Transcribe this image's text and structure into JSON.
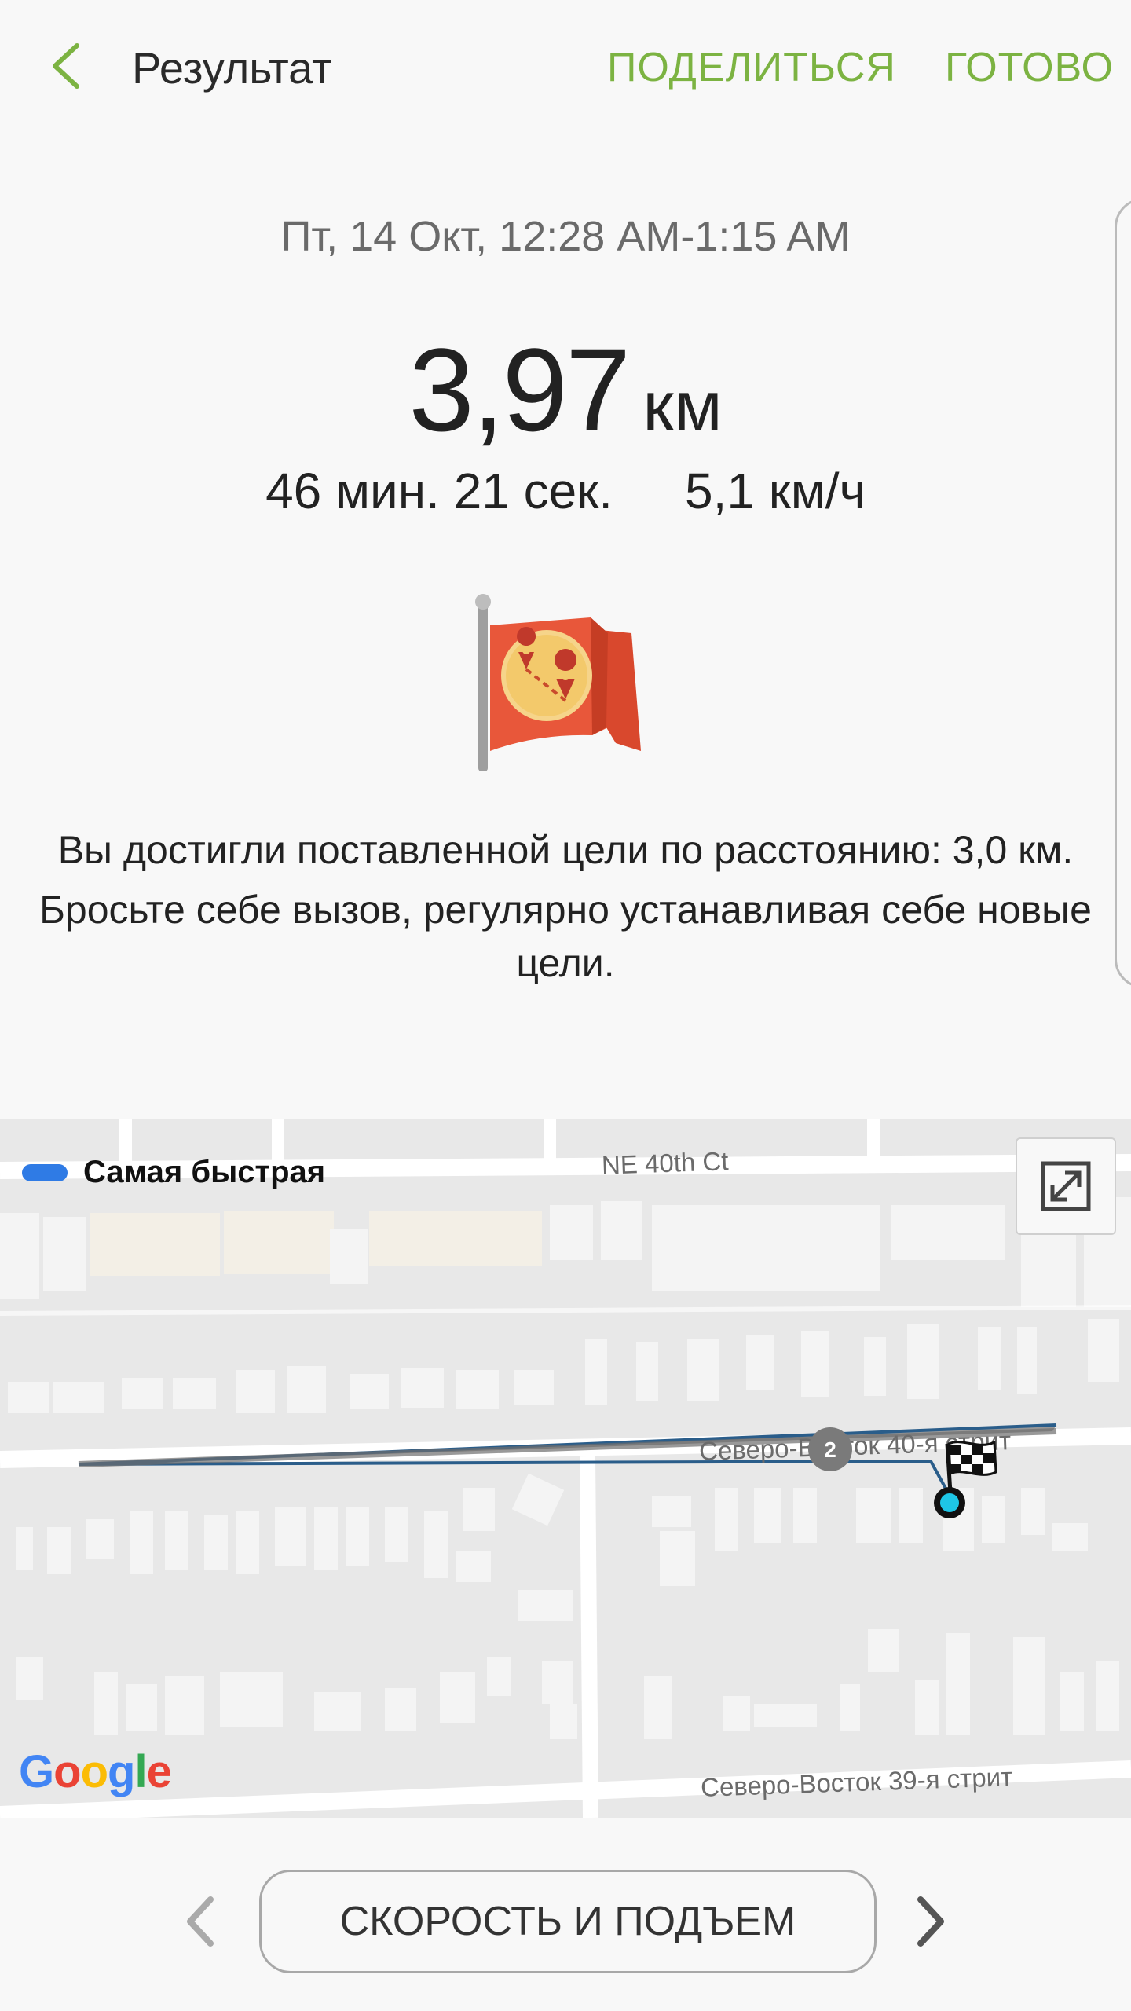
{
  "header": {
    "title": "Результат",
    "share_label": "ПОДЕЛИТЬСЯ",
    "done_label": "ГОТОВО"
  },
  "summary": {
    "date_range": "Пт, 14 Окт, 12:28 AM-1:15 AM",
    "distance_value": "3,97",
    "distance_unit": "км",
    "duration": "46 мин. 21 сек.",
    "speed": "5,1 км/ч"
  },
  "goal": {
    "line1": "Вы достигли поставленной цели по расстоянию: 3,0 км.",
    "line2": "Бросьте себе вызов, регулярно устанавливая себе новые цели."
  },
  "map": {
    "legend_label": "Самая быстрая",
    "legend_color": "#2f7be5",
    "streets": {
      "top": "NE 40th Ct",
      "middle": "Северо-Восток 40-я стрит",
      "bottom": "Северо-Восток 39-я стрит"
    },
    "lap_marker": "2",
    "provider": "Google"
  },
  "bottom_nav": {
    "button_label": "СКОРОСТЬ И ПОДЪЕМ"
  },
  "colors": {
    "accent": "#7cb342",
    "background": "#f8f8f8",
    "flag": "#e8573a"
  }
}
